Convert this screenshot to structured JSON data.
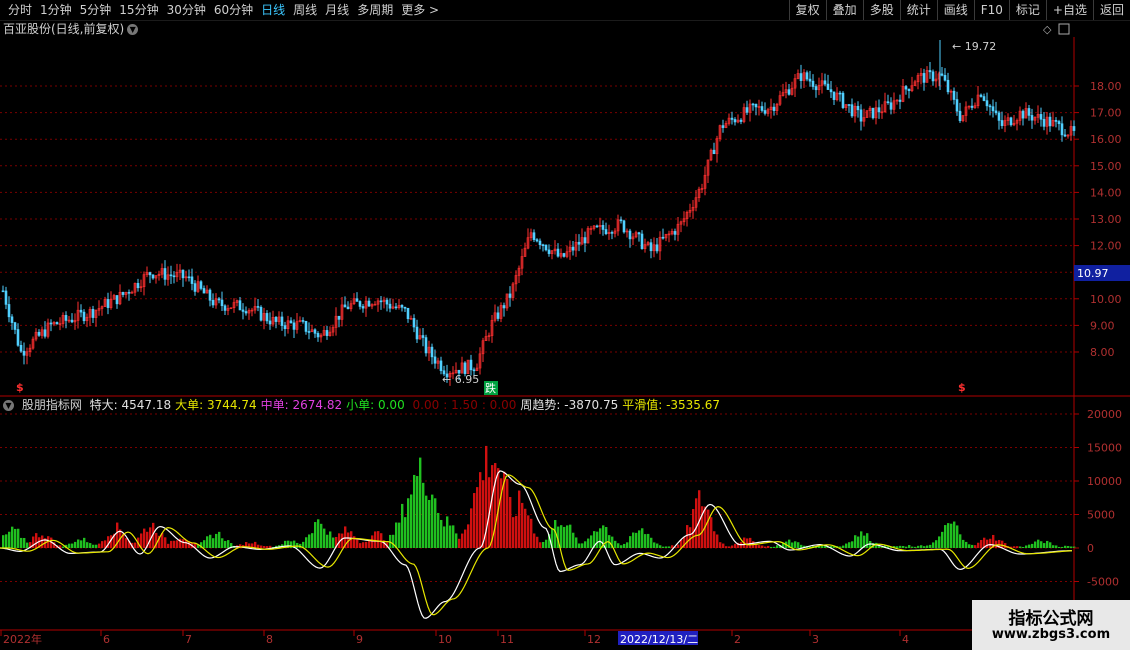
{
  "toolbar": {
    "periods": [
      "分时",
      "1分钟",
      "5分钟",
      "15分钟",
      "30分钟",
      "60分钟",
      "日线",
      "周线",
      "月线",
      "多周期",
      "更多 >"
    ],
    "active": "日线",
    "right_buttons": [
      "复权",
      "叠加",
      "多股",
      "统计",
      "画线",
      "F10",
      "标记",
      "+自选",
      "返回"
    ]
  },
  "title": "百亚股份(日线,前复权)",
  "price_panel": {
    "y_ticks": [
      "18.00",
      "17.00",
      "16.00",
      "15.00",
      "14.00",
      "13.00",
      "12.00",
      "11.00",
      "10.00",
      "9.00",
      "8.00"
    ],
    "current_price": "10.97",
    "high_label": "19.72",
    "low_label": "6.95",
    "signal_label": "跌",
    "dollar_marker": "$"
  },
  "indicator": {
    "name": "股朋指标网",
    "items": [
      {
        "label": "特大:",
        "value": "4547.18",
        "color": "#e0e0e0"
      },
      {
        "label": "大单:",
        "value": "3744.74",
        "color": "#e6e600"
      },
      {
        "label": "中单:",
        "value": "2674.82",
        "color": "#e040e0"
      },
      {
        "label": "小单:",
        "value": "0.00",
        "color": "#20e020"
      },
      {
        "label": "",
        "value": "0.00",
        "color": "#8a0000"
      },
      {
        "label": ":",
        "value": "1.50",
        "color": "#8a0000"
      },
      {
        "label": ":",
        "value": "0.00",
        "color": "#8a0000"
      },
      {
        "label": "周趋势:",
        "value": "-3870.75",
        "color": "#e0e0e0"
      },
      {
        "label": "平滑值:",
        "value": "-3535.67",
        "color": "#e6e600"
      }
    ],
    "y_ticks": [
      "20000",
      "15000",
      "10000",
      "5000",
      "0",
      "-5000"
    ]
  },
  "x_axis": {
    "labels": [
      "2022年",
      "6",
      "7",
      "8",
      "9",
      "10",
      "11",
      "12",
      "2022/12/13/二",
      "2",
      "3",
      "4"
    ]
  },
  "watermark": {
    "line1": "指标公式网",
    "line2": "www.zbgs3.com"
  },
  "colors": {
    "up": "#ff3030",
    "down": "#50d0ff",
    "vol_up": "#d01010",
    "vol_down": "#20c020",
    "grid": "#7a0000",
    "axis": "#b00000"
  }
}
